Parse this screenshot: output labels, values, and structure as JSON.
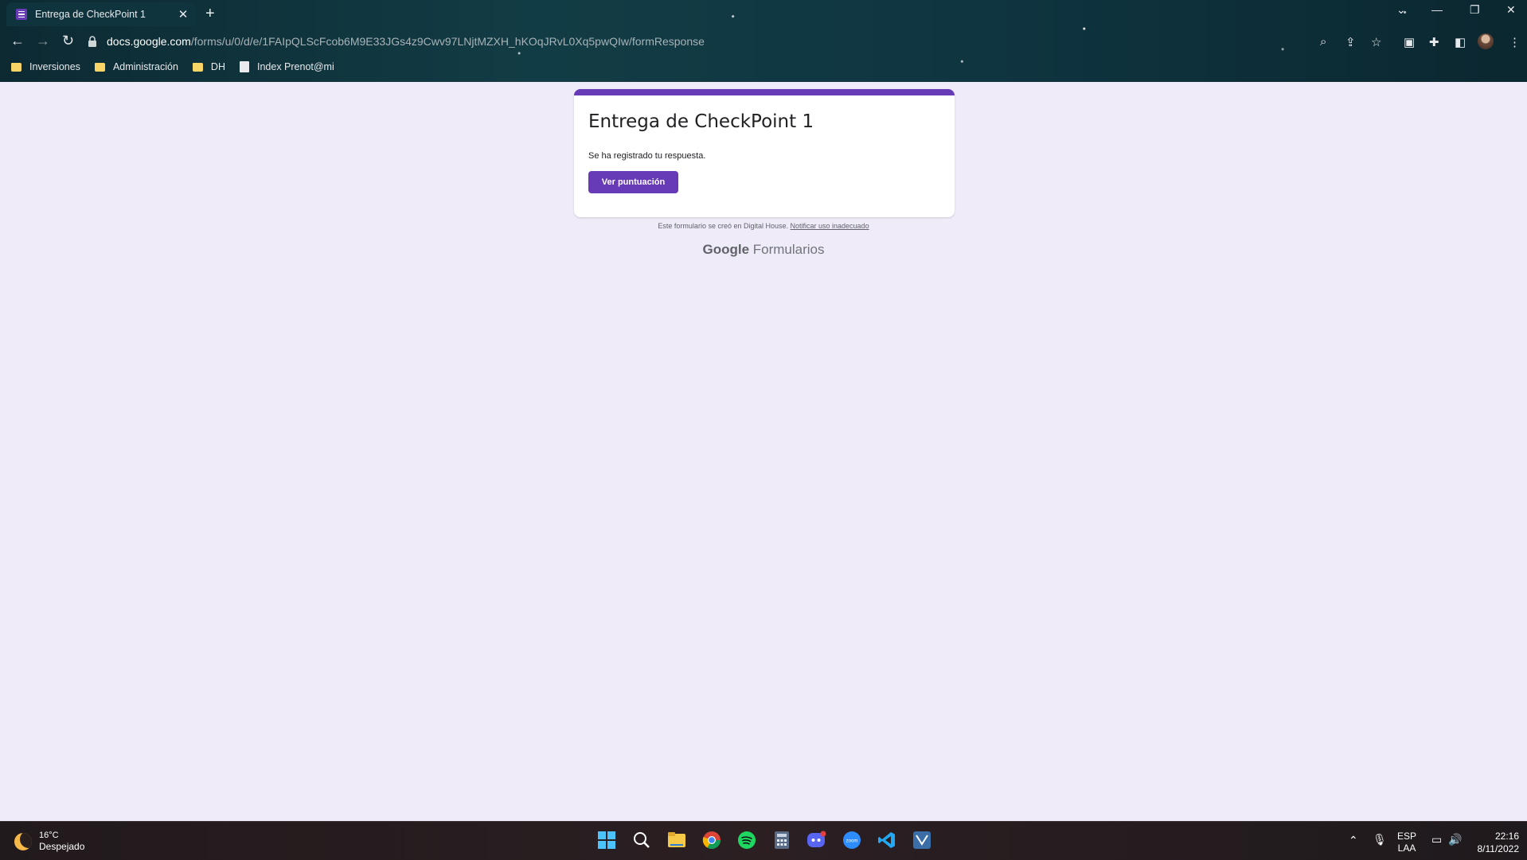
{
  "browser": {
    "tab_title": "Entrega de CheckPoint 1",
    "tab_close": "✕",
    "new_tab": "+",
    "url_host": "docs.google.com",
    "url_path": "/forms/u/0/d/e/1FAIpQLScFcob6M9E33JGs4z9Cwv97LNjtMZXH_hKOqJRvL0Xq5pwQIw/formResponse",
    "bookmarks": [
      {
        "label": "Inversiones",
        "icon": "folder-icon"
      },
      {
        "label": "Administración",
        "icon": "folder-icon"
      },
      {
        "label": "DH",
        "icon": "folder-icon"
      },
      {
        "label": "Index Prenot@mi",
        "icon": "page-icon"
      }
    ]
  },
  "form": {
    "title": "Entrega de CheckPoint 1",
    "message": "Se ha registrado tu respuesta.",
    "score_button": "Ver puntuación",
    "accent_color": "#673ab7",
    "page_background": "#f0ebf8"
  },
  "footer": {
    "created_note": "Este formulario se creó en Digital House.",
    "report_link": "Notificar uso inadecuado",
    "brand_google": "Google",
    "brand_product": "Formularios"
  },
  "taskbar": {
    "weather_temp": "16°C",
    "weather_condition": "Despejado",
    "apps": [
      "start-icon",
      "search-icon",
      "file-explorer-icon",
      "chrome-icon",
      "spotify-icon",
      "calculator-icon",
      "discord-icon",
      "zoom-icon",
      "vscode-icon",
      "app-icon"
    ],
    "lang": "ESP",
    "layout": "LAA",
    "time": "22:16",
    "date": "8/11/2022"
  }
}
